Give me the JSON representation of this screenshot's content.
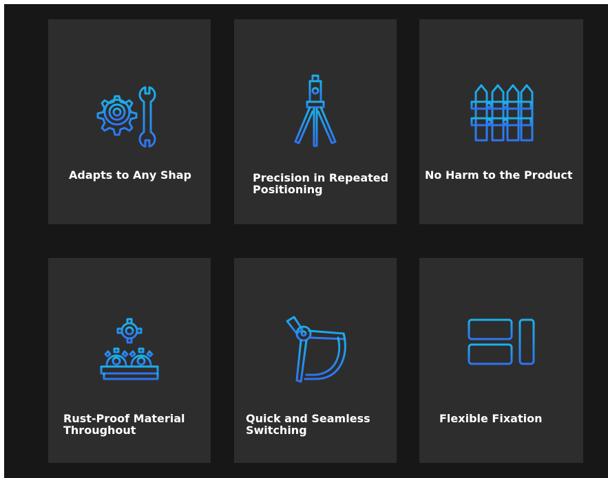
{
  "accent_gradient": [
    "#1aa7e6",
    "#2f7df0"
  ],
  "features": [
    {
      "icon": "gear-wrench-icon",
      "label": "Adapts to Any Shap"
    },
    {
      "icon": "tripod-level-icon",
      "label": "Precision in Repeated\nPositioning"
    },
    {
      "icon": "fence-icon",
      "label": "No Harm to the Product"
    },
    {
      "icon": "gears-on-base-icon",
      "label": "Rust-Proof Material\nThroughout"
    },
    {
      "icon": "drafting-compass-icon",
      "label": "Quick and Seamless\nSwitching"
    },
    {
      "icon": "layout-blocks-icon",
      "label": "Flexible Fixation"
    }
  ]
}
